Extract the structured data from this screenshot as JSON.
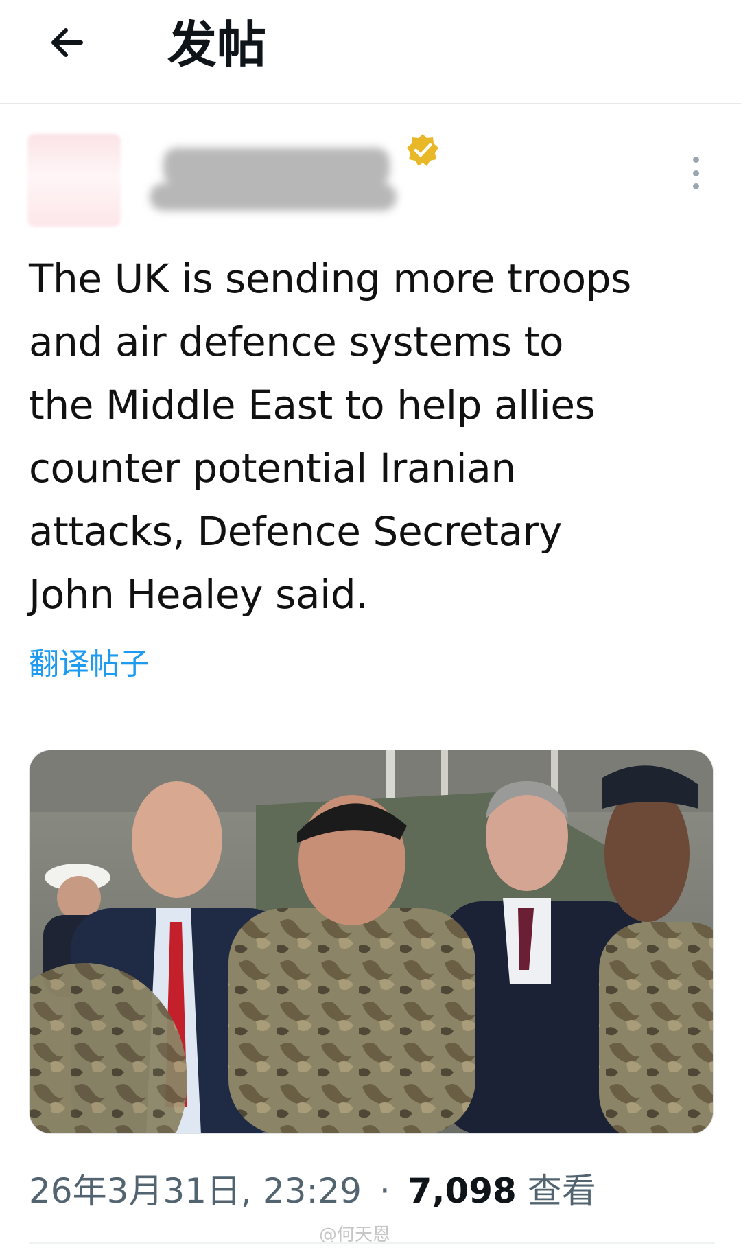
{
  "header": {
    "back_icon": "arrow-left-icon",
    "title": "发帖"
  },
  "post": {
    "verified_icon": "verified-badge-icon",
    "more_icon": "more-vertical-icon",
    "text_lines": [
      "The UK is sending more troops",
      "and air defence systems to",
      "the Middle East to help allies",
      "counter potential Iranian",
      "attacks, Defence Secretary",
      "John Healey said."
    ],
    "translate_label": "翻译帖子",
    "timestamp": "26年3月31日, 23:29",
    "separator": "·",
    "views_count": "7,098",
    "views_label": "查看"
  },
  "watermark": "@何天恩",
  "colors": {
    "accent": "#1d9bf0",
    "verified_gold": "#e8b829",
    "meta_gray": "#536471"
  }
}
